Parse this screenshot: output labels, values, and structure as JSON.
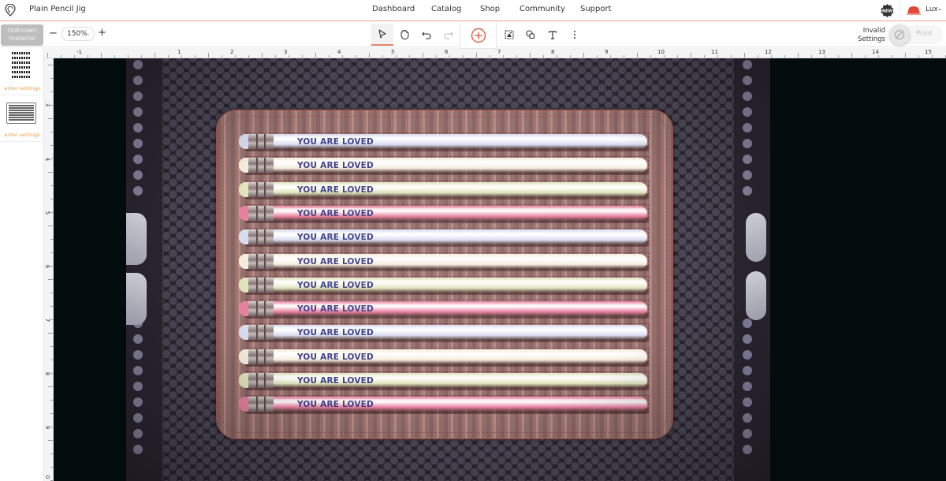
{
  "header": {
    "doc_title": "Plain Pencil Jig",
    "nav": [
      "Dashboard",
      "Catalog",
      "Shop",
      "Community",
      "Support"
    ],
    "new_badge": "NEW",
    "user_name": "Lux"
  },
  "toolbar": {
    "material_label": "Unknown material",
    "zoom_value": "150%",
    "zoom_minus": "−",
    "zoom_plus": "+",
    "tools": [
      "select",
      "pan",
      "undo",
      "redo",
      "add",
      "trace",
      "shapes",
      "text",
      "more"
    ],
    "status_label": "Invalid Settings",
    "print_label": "Print"
  },
  "sidebar": {
    "items": [
      {
        "name": "text-engrave",
        "label": "enter settings"
      },
      {
        "name": "jig-engrave",
        "label": "enter settings"
      }
    ]
  },
  "rulers": {
    "top": [
      "-1",
      "1",
      "2",
      "3",
      "4",
      "5",
      "6",
      "7",
      "8",
      "9",
      "10",
      "11",
      "12",
      "13",
      "14",
      "15"
    ],
    "left": [
      "3",
      "4",
      "5",
      "6",
      "7",
      "8",
      "9",
      "0"
    ]
  },
  "canvas": {
    "pencil_text": "YOU ARE LOVED",
    "pencils": [
      {
        "color": "blue"
      },
      {
        "color": "cream"
      },
      {
        "color": "green"
      },
      {
        "color": "pink"
      },
      {
        "color": "blue"
      },
      {
        "color": "cream"
      },
      {
        "color": "green"
      },
      {
        "color": "pink"
      },
      {
        "color": "blue"
      },
      {
        "color": "cream"
      },
      {
        "color": "green"
      },
      {
        "color": "pink"
      }
    ],
    "palette": {
      "blue": "#d7dcef",
      "cream": "#f5ecdc",
      "green": "#e0e4bc",
      "pink": "#e8809e",
      "text": "#3d3f86",
      "accent": "#e4836a"
    }
  }
}
